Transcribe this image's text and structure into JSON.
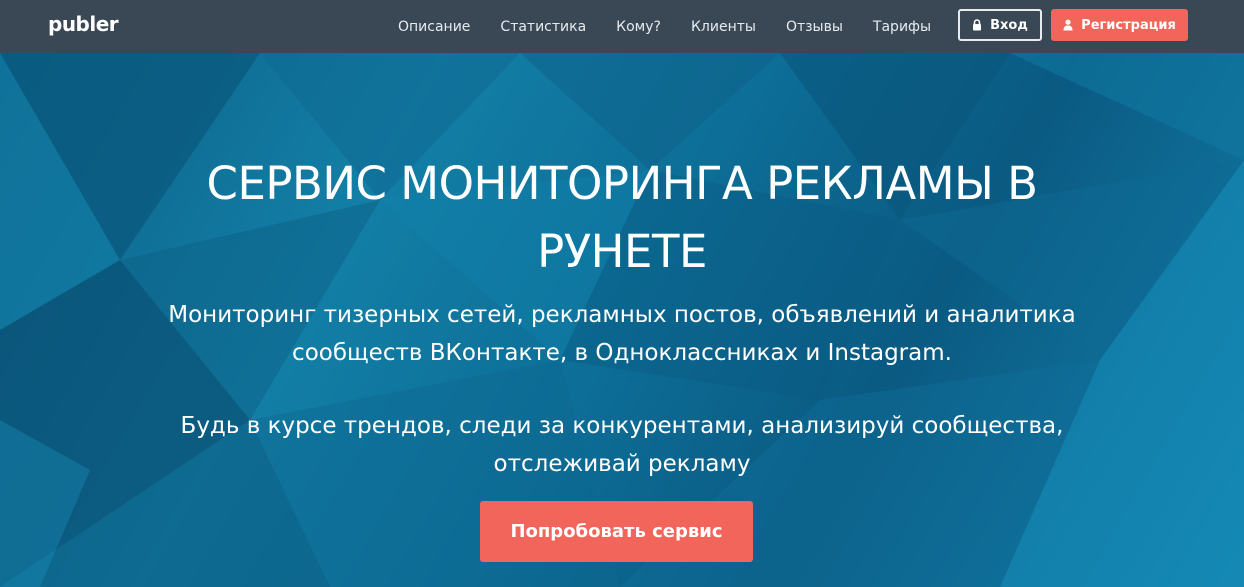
{
  "brand": {
    "logo": "publer"
  },
  "nav": {
    "links": [
      {
        "label": "Описание"
      },
      {
        "label": "Статистика"
      },
      {
        "label": "Кому?"
      },
      {
        "label": "Клиенты"
      },
      {
        "label": "Отзывы"
      },
      {
        "label": "Тарифы"
      }
    ],
    "login_label": "Вход",
    "login_icon": "lock-icon",
    "register_label": "Регистрация",
    "register_icon": "user-icon"
  },
  "hero": {
    "title_line1": "СЕРВИС МОНИТОРИНГА РЕКЛАМЫ В",
    "title_line2": "РУНЕТЕ",
    "subtitle1_line1": "Мониторинг тизерных сетей, рекламных постов, объявлений и аналитика",
    "subtitle1_line2": "сообществ ВКонтакте, в Одноклассниках и Instagram.",
    "subtitle2_line1": "Будь в курсе трендов, следи за конкурентами, анализируй сообщества,",
    "subtitle2_line2": "отслеживай рекламу",
    "cta_label": "Попробовать сервис"
  },
  "colors": {
    "navbar": "#3a4754",
    "accent": "#f2655a",
    "hero_base": "#0e6a94"
  }
}
